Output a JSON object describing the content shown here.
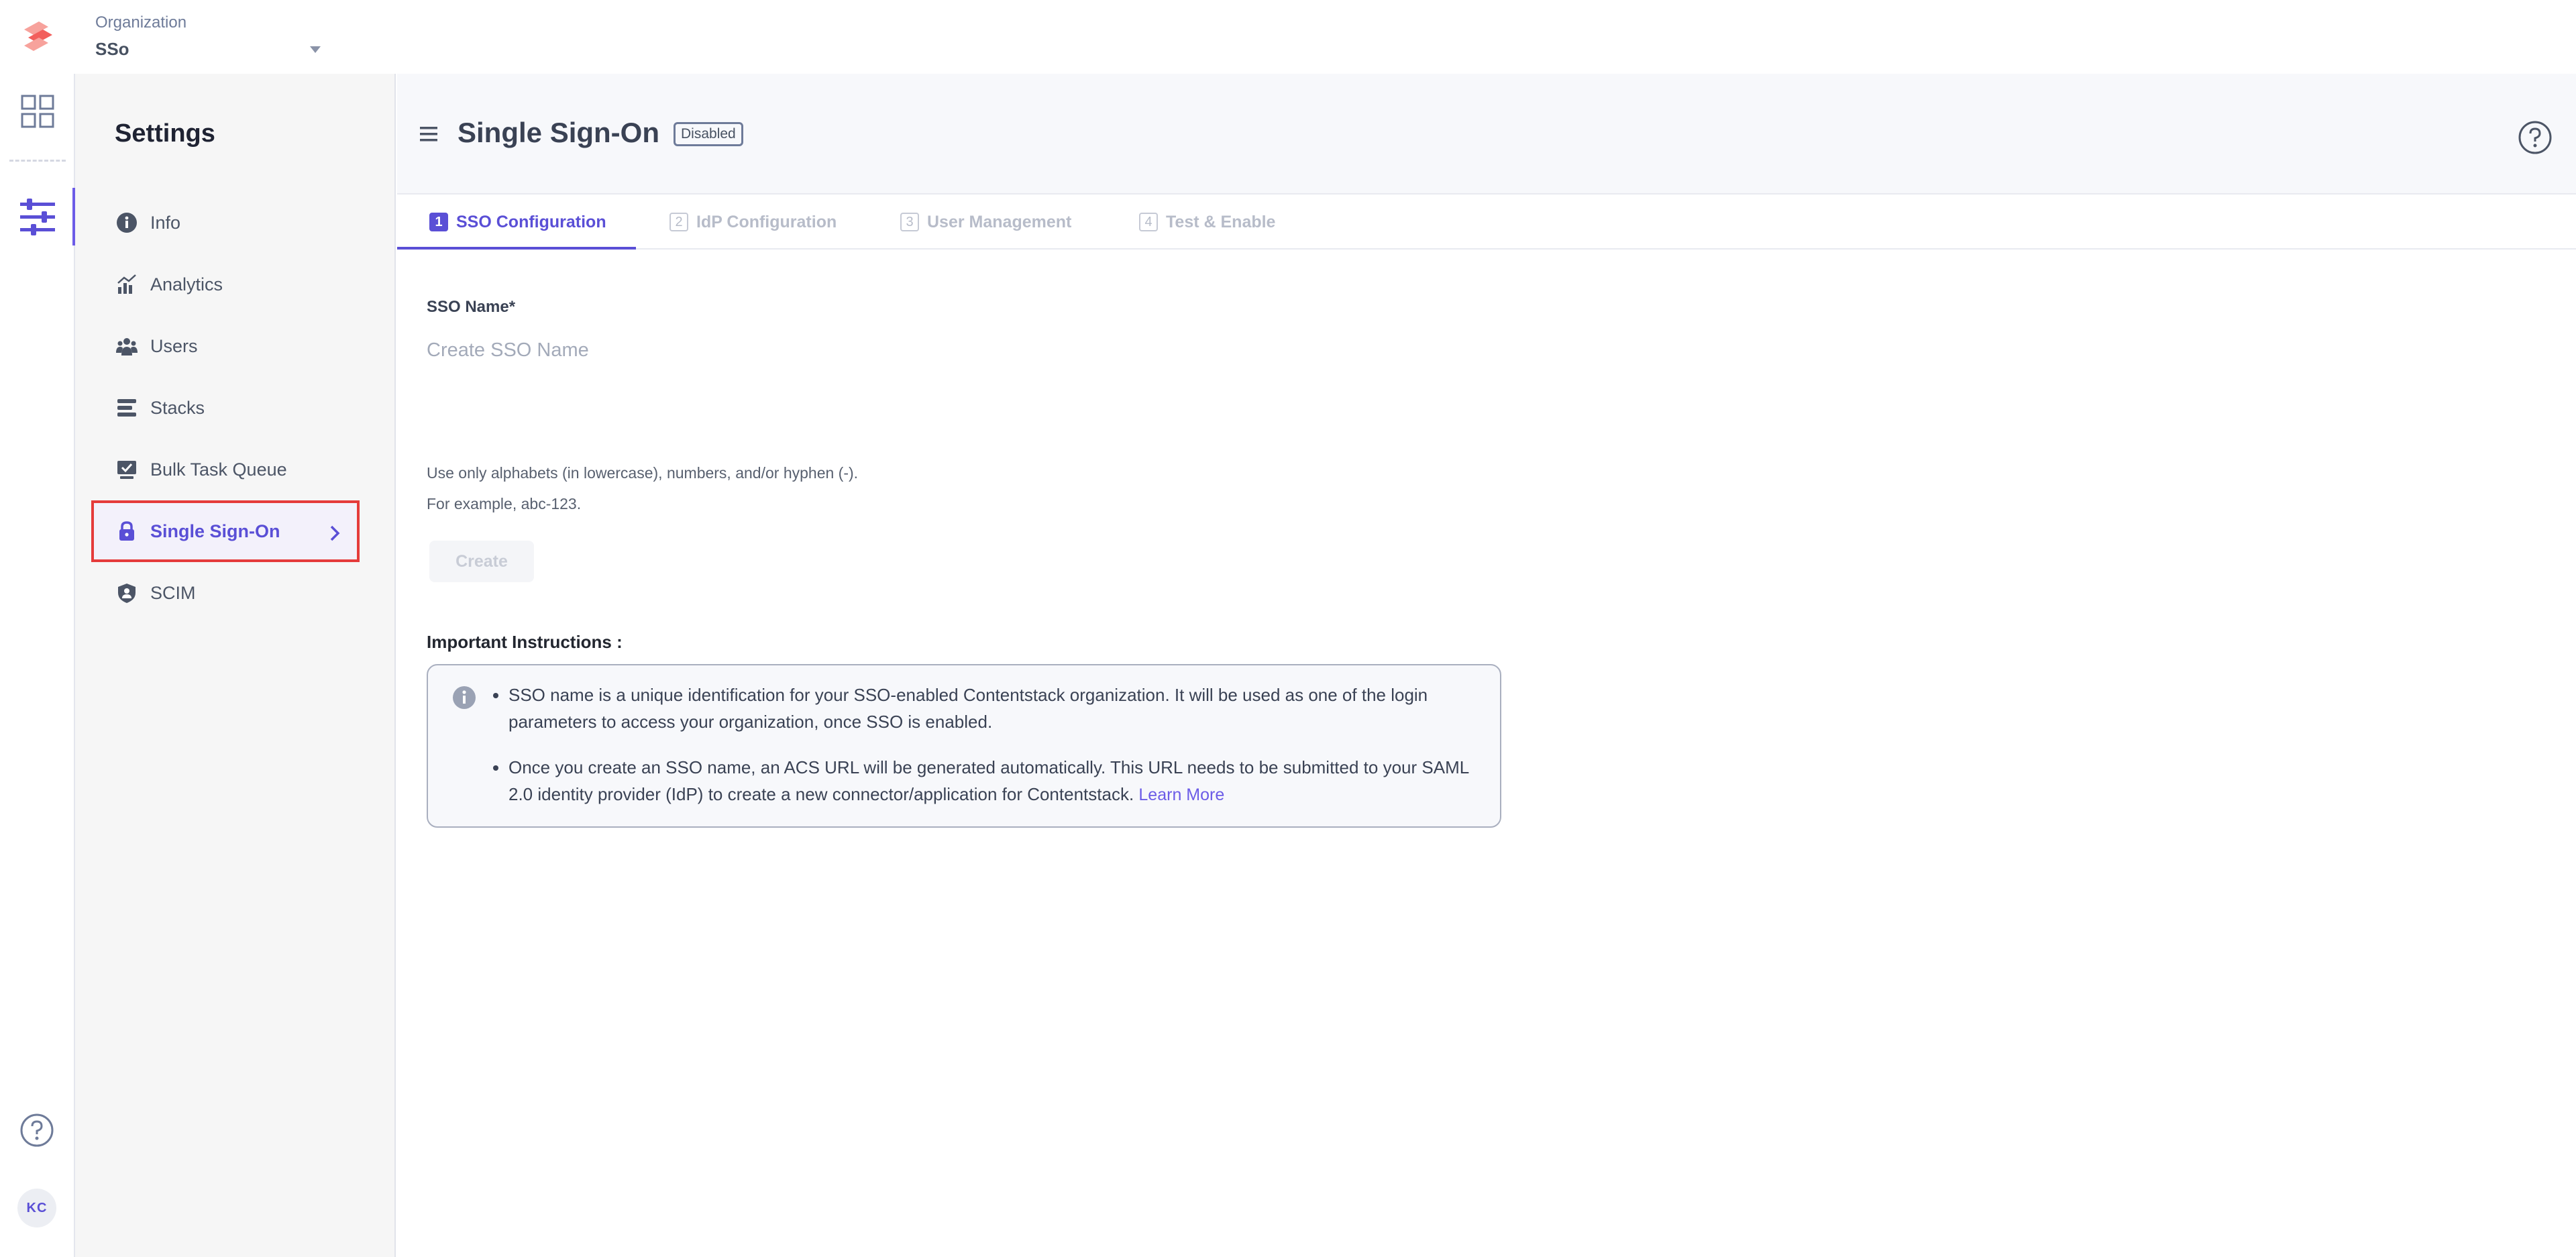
{
  "header": {
    "org_label": "Organization",
    "org_name": "SSo"
  },
  "rail": {
    "avatar_initials": "KC"
  },
  "sidebar": {
    "title": "Settings",
    "items": [
      {
        "label": "Info",
        "icon": "info-icon"
      },
      {
        "label": "Analytics",
        "icon": "analytics-icon"
      },
      {
        "label": "Users",
        "icon": "users-icon"
      },
      {
        "label": "Stacks",
        "icon": "stacks-icon"
      },
      {
        "label": "Bulk Task Queue",
        "icon": "bulk-task-icon"
      },
      {
        "label": "Single Sign-On",
        "icon": "lock-icon",
        "active": true
      },
      {
        "label": "SCIM",
        "icon": "shield-user-icon"
      }
    ]
  },
  "main": {
    "title": "Single Sign-On",
    "status": "Disabled",
    "tabs": [
      {
        "num": "1",
        "label": "SSO Configuration",
        "active": true
      },
      {
        "num": "2",
        "label": "IdP Configuration"
      },
      {
        "num": "3",
        "label": "User Management"
      },
      {
        "num": "4",
        "label": "Test & Enable"
      }
    ],
    "field_label": "SSO Name*",
    "input_placeholder": "Create SSO Name",
    "helper_line1": "Use only alphabets (in lowercase), numbers, and/or hyphen (-).",
    "helper_line2": "For example, abc-123.",
    "create_label": "Create",
    "instructions_title": "Important Instructions :",
    "instruction_1": "SSO name is a unique identification for your SSO-enabled Contentstack organization. It will be used as one of the login parameters to access your organization, once SSO is enabled.",
    "instruction_2": "Once you create an SSO name, an ACS URL will be generated automatically. This URL needs to be submitted to your SAML 2.0 identity provider (IdP) to create a new connector/application for Contentstack.",
    "learn_more": "Learn More"
  },
  "colors": {
    "accent": "#5a4fd6",
    "highlight_border": "#e53b3b",
    "logo": "#f25f5c"
  }
}
